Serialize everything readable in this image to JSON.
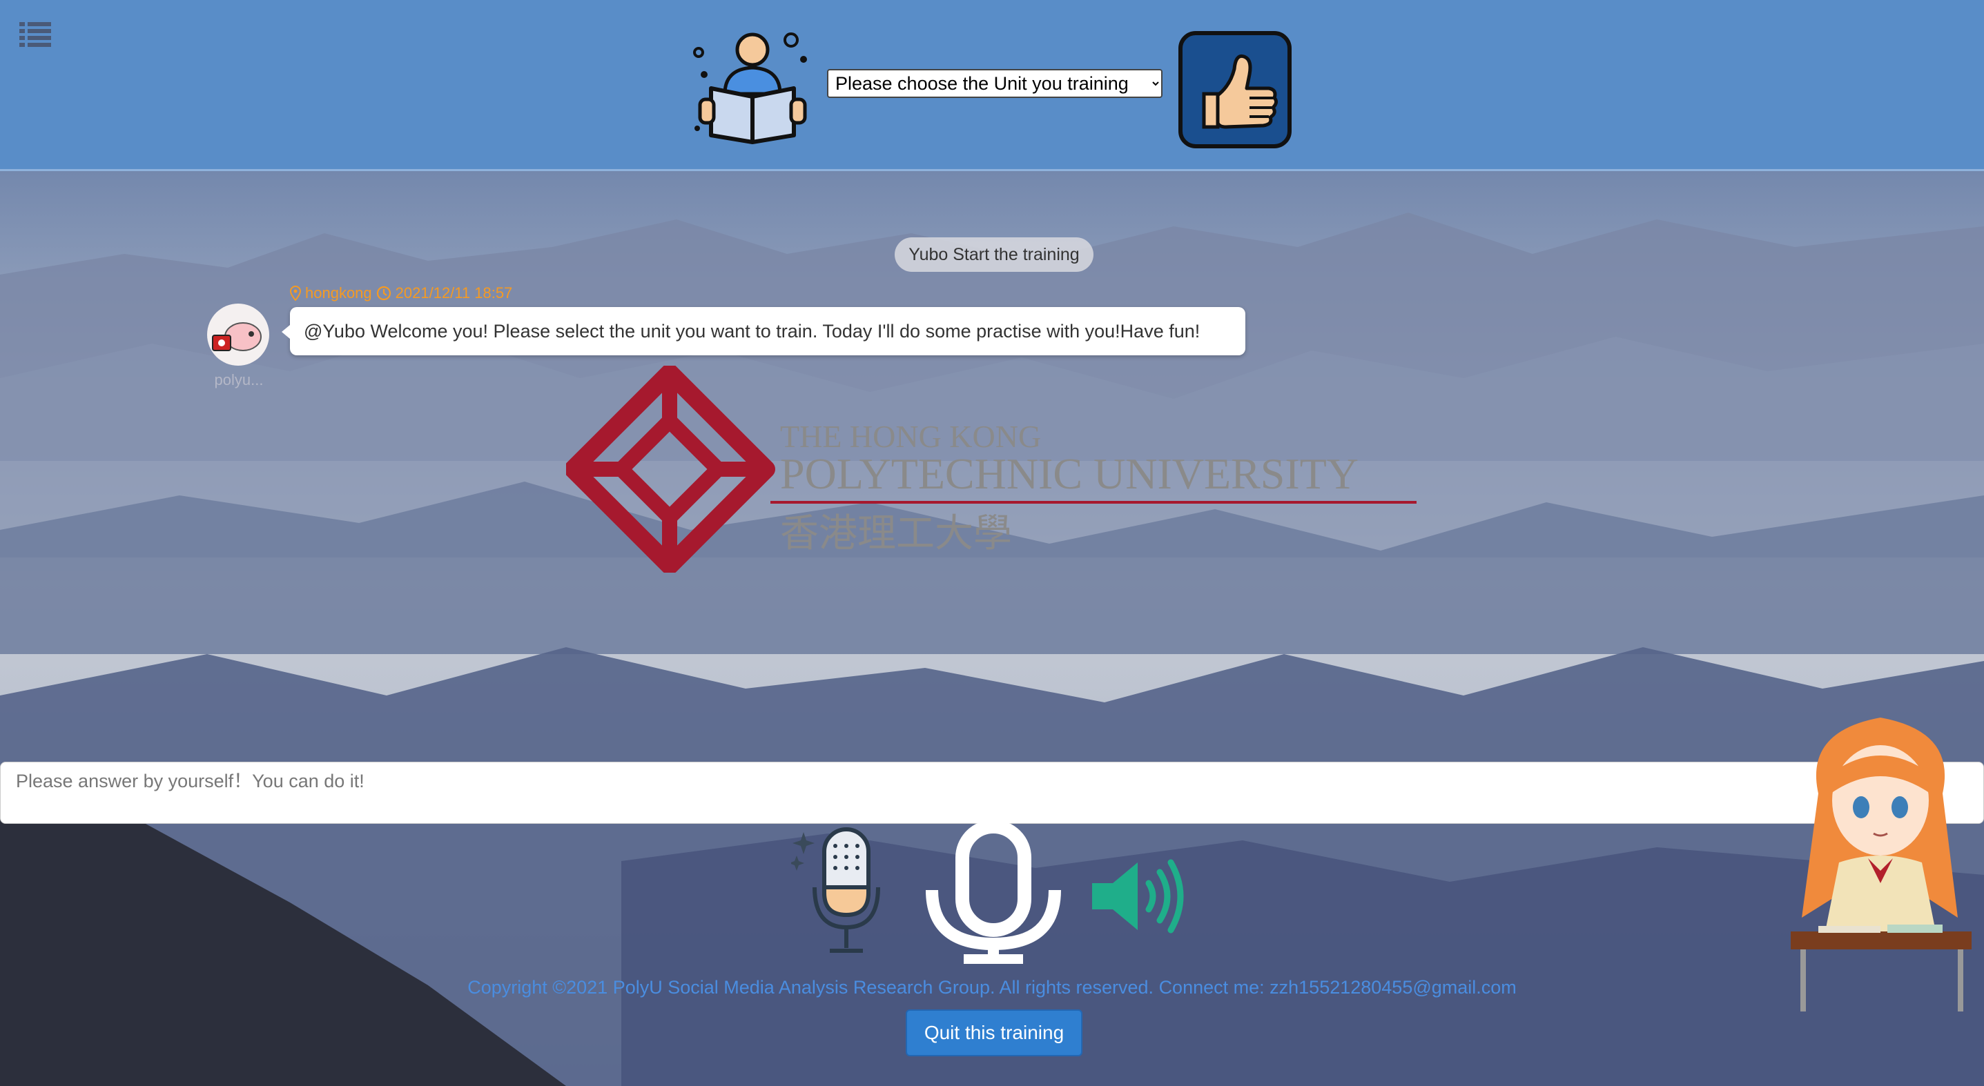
{
  "header": {
    "unit_select": {
      "selected": "Please choose the Unit you training",
      "options": [
        "Please choose the Unit you training"
      ]
    },
    "icons": [
      "list-menu-icon",
      "reader-book-icon",
      "thumbs-up-icon"
    ]
  },
  "chat": {
    "system_notice": "Yubo Start the training",
    "message": {
      "location": "hongkong",
      "timestamp": "2021/12/11 18:57",
      "text": "@Yubo Welcome you! Please select the unit you want to train. Today I'll do some practise with you!Have fun!",
      "sender_name": "polyu..."
    }
  },
  "logo": {
    "line1": "THE HONG KONG",
    "line2": "POLYTECHNIC UNIVERSITY",
    "line3": "香港理工大學",
    "color": "#a6192e"
  },
  "answer": {
    "placeholder": "Please answer by yourself！You can do it!"
  },
  "controls": {
    "icons": [
      "microphone-icon",
      "voice-record-icon",
      "speaker-icon"
    ]
  },
  "footer": {
    "copyright": "Copyright ©2021 PolyU Social Media Analysis Research Group. All rights reserved. Connect me: zzh15521280455@gmail.com",
    "quit_label": "Quit this training"
  },
  "colors": {
    "header_bg": "#598dc8",
    "accent": "#2f7fd0",
    "meta": "#f59a23",
    "link": "#4a8de0"
  }
}
